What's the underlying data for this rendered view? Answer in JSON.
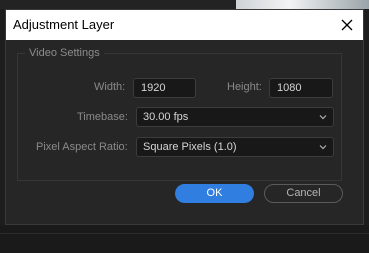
{
  "dialog": {
    "title": "Adjustment Layer"
  },
  "video_settings": {
    "legend": "Video Settings",
    "width_label": "Width:",
    "width_value": "1920",
    "height_label": "Height:",
    "height_value": "1080",
    "timebase_label": "Timebase:",
    "timebase_value": "30.00 fps",
    "par_label": "Pixel Aspect Ratio:",
    "par_value": "Square Pixels (1.0)"
  },
  "buttons": {
    "ok_label": "OK",
    "cancel_label": "Cancel"
  },
  "colors": {
    "accent": "#2f7ee0",
    "dialog_bg": "#262626",
    "titlebar_bg": "#ffffff"
  },
  "icons": {
    "close": "close-icon",
    "dropdown": "chevron-down-icon"
  }
}
